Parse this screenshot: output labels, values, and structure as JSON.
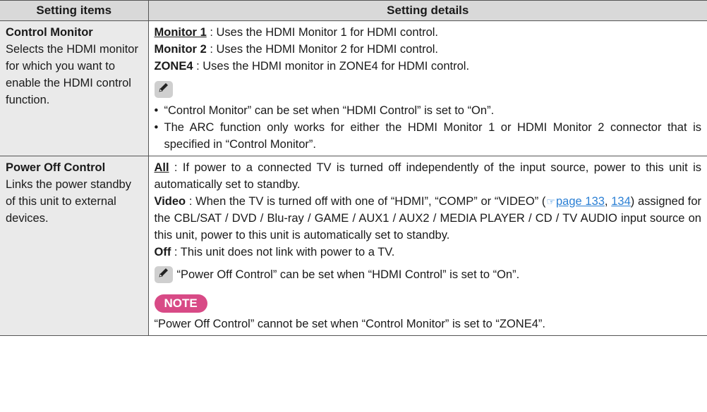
{
  "headers": {
    "items": "Setting items",
    "details": "Setting details"
  },
  "row1": {
    "title": "Control Monitor",
    "desc": "Selects the HDMI monitor for which you want to enable the HDMI control function.",
    "opt1_term": "Monitor 1",
    "opt1_text": " : Uses the HDMI Monitor 1 for HDMI control.",
    "opt2_term": "Monitor 2",
    "opt2_text": " : Uses the HDMI Monitor 2 for HDMI control.",
    "opt3_term": "ZONE4",
    "opt3_text": " : Uses the HDMI monitor in ZONE4 for HDMI control.",
    "bullet1": "“Control Monitor” can be set when “HDMI Control” is set to “On”.",
    "bullet2": "The ARC function only works for either the HDMI Monitor 1 or HDMI Monitor 2 connector that is specified in “Control Monitor”."
  },
  "row2": {
    "title": "Power Off Control",
    "desc": "Links the power standby of this unit to external devices.",
    "all_term": "All",
    "all_text": " : If power to a connected TV is turned off independently of the input source, power to this unit is automatically set to standby.",
    "video_term": "Video",
    "video_text_a": " : When the TV is turned off with one of “HDMI”, “COMP” or “VIDEO” (",
    "video_link1": "page 133",
    "video_sep": ", ",
    "video_link2": "134",
    "video_text_b": ") assigned for the CBL/SAT / DVD / Blu-ray / GAME / AUX1 / AUX2 / MEDIA PLAYER / CD / TV AUDIO input source on this unit, power to this unit is automatically set to standby.",
    "off_term": "Off",
    "off_text": " : This unit does not link with power to a TV.",
    "memo": "“Power Off Control” can be set when “HDMI Control” is set to “On”.",
    "note_label": "NOTE",
    "note_text": "“Power Off Control” cannot be set when “Control Monitor” is set to “ZONE4”."
  },
  "icons": {
    "memo": "pencil-icon",
    "reference": "pointing-hand-icon"
  },
  "colors": {
    "header_bg": "#d9d9d9",
    "items_bg": "#eaeaea",
    "link": "#2a7fd4",
    "note_badge": "#d84a86"
  }
}
